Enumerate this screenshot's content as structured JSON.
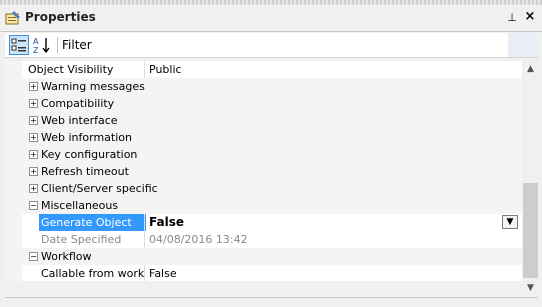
{
  "window": {
    "title": "Properties"
  },
  "toolbar": {
    "filter_label": "Filter"
  },
  "rows": [
    {
      "kind": "prop",
      "name": "Object Visibility",
      "value": "Public"
    },
    {
      "kind": "cat",
      "name": "Warning messages",
      "expander": "+"
    },
    {
      "kind": "cat",
      "name": "Compatibility",
      "expander": "+"
    },
    {
      "kind": "cat",
      "name": "Web interface",
      "expander": "+"
    },
    {
      "kind": "cat",
      "name": "Web information",
      "expander": "+"
    },
    {
      "kind": "cat",
      "name": "Key configuration",
      "expander": "+"
    },
    {
      "kind": "cat",
      "name": "Refresh timeout",
      "expander": "+"
    },
    {
      "kind": "cat",
      "name": "Client/Server specific",
      "expander": "+"
    },
    {
      "kind": "cat",
      "name": "Miscellaneous",
      "expander": "−"
    },
    {
      "kind": "sel",
      "name": "Generate Object",
      "value": "False"
    },
    {
      "kind": "dis",
      "name": "Date Specified",
      "value": "04/08/2016 13:42"
    },
    {
      "kind": "cat",
      "name": "Workflow",
      "expander": "−"
    },
    {
      "kind": "prop",
      "name": "Callable from workflow",
      "value": "False"
    }
  ],
  "colors": {
    "selection": "#3399ff",
    "category_bg": "#f4f4f4"
  }
}
